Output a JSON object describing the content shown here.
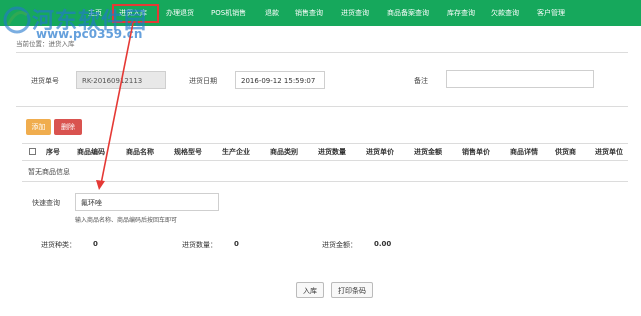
{
  "watermark": {
    "title": "河东软件园",
    "url": "www.pc0359.cn"
  },
  "nav": {
    "items": [
      {
        "label": "主页"
      },
      {
        "label": "进货入库"
      },
      {
        "label": "办理退货"
      },
      {
        "label": "POS机销售"
      },
      {
        "label": "退款"
      },
      {
        "label": "销售查询"
      },
      {
        "label": "进货查询"
      },
      {
        "label": "商品备案查询"
      },
      {
        "label": "库存查询"
      },
      {
        "label": "欠款查询"
      },
      {
        "label": "客户管理"
      }
    ],
    "active_index": 1
  },
  "breadcrumb": "当前位置：进货入库",
  "form": {
    "order_no_label": "进货单号",
    "order_no_value": "RK-20160912113",
    "date_label": "进货日期",
    "date_value": "2016-09-12 15:59:07",
    "remark_label": "备注",
    "remark_value": ""
  },
  "toolbar": {
    "add_label": "添加",
    "delete_label": "删除"
  },
  "table": {
    "headers": [
      "序号",
      "商品编码",
      "商品名称",
      "规格型号",
      "生产企业",
      "商品类别",
      "进货数量",
      "进货单价",
      "进货金额",
      "销售单价",
      "商品详情",
      "供货商",
      "进货单位"
    ],
    "empty_message": "暂无商品信息"
  },
  "quick_search": {
    "label": "快速查询",
    "value": "氟环唑",
    "hint": "输入商品名称、商品编码后按回车即可"
  },
  "summary": {
    "type_label": "进货种类：",
    "type_value": "0",
    "qty_label": "进货数量：",
    "qty_value": "0",
    "amount_label": "进货金额：",
    "amount_value": "0.00"
  },
  "actions": {
    "stock_in_label": "入库",
    "print_label": "打印条码"
  },
  "colors": {
    "nav_bg": "#16a85c",
    "add_btn": "#f0ad4e",
    "delete_btn": "#d9534f",
    "annotation": "#e53935",
    "watermark": "#2378cd"
  }
}
